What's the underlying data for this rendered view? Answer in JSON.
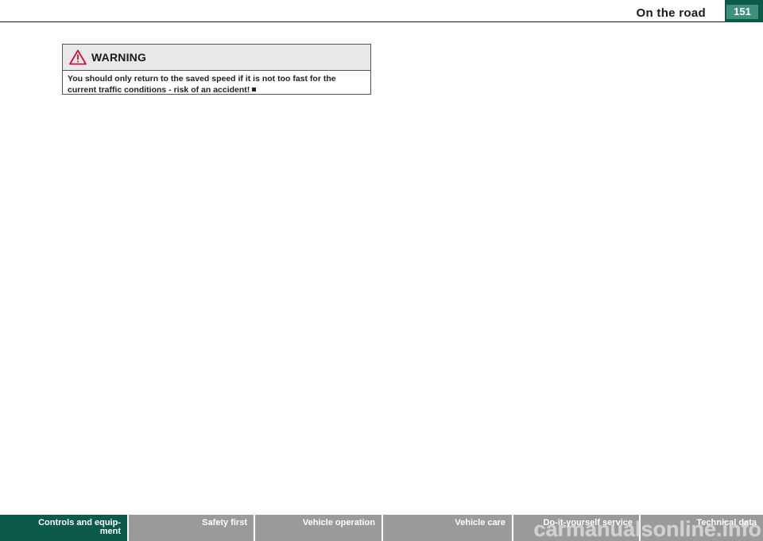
{
  "header": {
    "section_title": "On the road",
    "page_number": "151"
  },
  "warning": {
    "title": "WARNING",
    "body": "You should only return to the saved speed if it is not too fast for the current traffic conditions - risk of an accident!"
  },
  "footer_nav": {
    "tabs": [
      {
        "label": "Controls and equip-\nment",
        "active": true
      },
      {
        "label": "Safety first",
        "active": false
      },
      {
        "label": "Vehicle operation",
        "active": false
      },
      {
        "label": "Vehicle care",
        "active": false
      },
      {
        "label": "Do-it-yourself service",
        "active": false
      },
      {
        "label": "Technical data",
        "active": false
      }
    ]
  },
  "watermark": {
    "text": "carmanualsonline.info"
  },
  "colors": {
    "accent_green": "#0c5a4a",
    "tab_grey": "#9a9a9a",
    "warning_icon": "#d0103a"
  }
}
